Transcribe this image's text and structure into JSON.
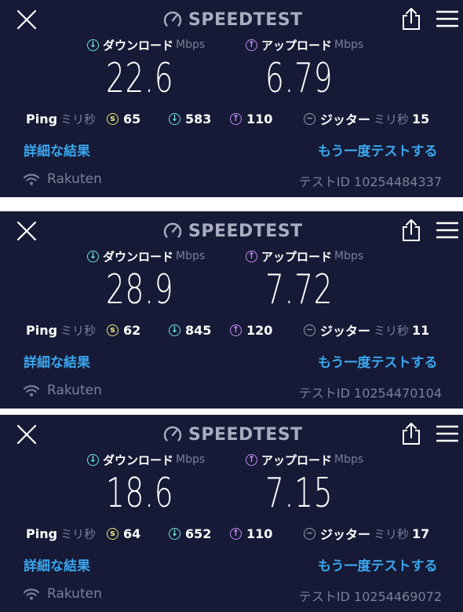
{
  "app": {
    "title": "SPEEDTEST",
    "download_label": "ダウンロード",
    "upload_label": "アップロード",
    "speed_unit": "Mbps",
    "ping_label": "Ping",
    "ms_unit": "ミリ秒",
    "jitter_label": "ジッター",
    "details_link": "詳細な結果",
    "test_again_link": "もう一度テストする",
    "icons": {
      "close": "close-icon",
      "share": "share-icon",
      "menu": "menu-icon",
      "gauge": "gauge-icon",
      "download": "download-arrow-icon",
      "upload": "upload-arrow-icon",
      "idle_latency": "idle-latency-icon",
      "jitter": "jitter-icon",
      "wifi": "wifi-icon"
    },
    "colors": {
      "background": "#161a36",
      "accent_link": "#3aa6ec",
      "download": "#6fe3d6",
      "upload": "#c58bf3",
      "idle": "#ece77a",
      "muted": "#7b7f9a"
    }
  },
  "results": [
    {
      "download": "22.6",
      "upload": "6.79",
      "ping_idle": "65",
      "ping_download": "583",
      "ping_upload": "110",
      "jitter": "15",
      "isp": "Rakuten",
      "test_id": "テストID 10254484337"
    },
    {
      "download": "28.9",
      "upload": "7.72",
      "ping_idle": "62",
      "ping_download": "845",
      "ping_upload": "120",
      "jitter": "11",
      "isp": "Rakuten",
      "test_id": "テストID 10254470104"
    },
    {
      "download": "18.6",
      "upload": "7.15",
      "ping_idle": "64",
      "ping_download": "652",
      "ping_upload": "110",
      "jitter": "17",
      "isp": "Rakuten",
      "test_id": "テストID 10254469072"
    }
  ]
}
